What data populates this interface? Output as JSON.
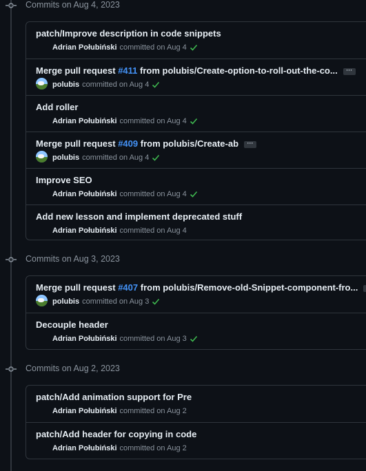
{
  "groups": [
    {
      "date_label": "Commits on Aug 4, 2023",
      "commits": [
        {
          "title": "patch/Improve description in code snippets",
          "author": "Adrian Połubiński",
          "committed": "committed on Aug 4",
          "verified": true
        },
        {
          "title_prefix": "Merge pull request ",
          "pr": "#411",
          "title_suffix": " from polubis/Create-option-to-roll-out-the-co...",
          "author": "polubis",
          "committed": "committed on Aug 4",
          "verified": true,
          "ellipsis": "···"
        },
        {
          "title": "Add roller",
          "author": "Adrian Połubiński",
          "committed": "committed on Aug 4",
          "verified": true
        },
        {
          "title_prefix": "Merge pull request ",
          "pr": "#409",
          "title_suffix": " from polubis/Create-ab",
          "author": "polubis",
          "committed": "committed on Aug 4",
          "verified": true,
          "ellipsis": "···"
        },
        {
          "title": "Improve SEO",
          "author": "Adrian Połubiński",
          "committed": "committed on Aug 4",
          "verified": true
        },
        {
          "title": "Add new lesson and implement deprecated stuff",
          "author": "Adrian Połubiński",
          "committed": "committed on Aug 4",
          "verified": false
        }
      ]
    },
    {
      "date_label": "Commits on Aug 3, 2023",
      "commits": [
        {
          "title_prefix": "Merge pull request ",
          "pr": "#407",
          "title_suffix": " from polubis/Remove-old-Snippet-component-fro...",
          "author": "polubis",
          "committed": "committed on Aug 3",
          "verified": true,
          "ellipsis": "···"
        },
        {
          "title": "Decouple header",
          "author": "Adrian Połubiński",
          "committed": "committed on Aug 3",
          "verified": true
        }
      ]
    },
    {
      "date_label": "Commits on Aug 2, 2023",
      "commits": [
        {
          "title": "patch/Add animation support for Pre",
          "author": "Adrian Połubiński",
          "committed": "committed on Aug 2",
          "verified": false
        },
        {
          "title": "patch/Add header for copying in code",
          "author": "Adrian Połubiński",
          "committed": "committed on Aug 2",
          "verified": false
        }
      ]
    }
  ],
  "colors": {
    "link": "#4493f8",
    "check": "#3fb950",
    "border": "#30363d",
    "background": "#0d1117"
  },
  "icons": {
    "timeline_node": "git-commit-icon",
    "verified": "check-icon",
    "avatar": "user-avatar"
  }
}
